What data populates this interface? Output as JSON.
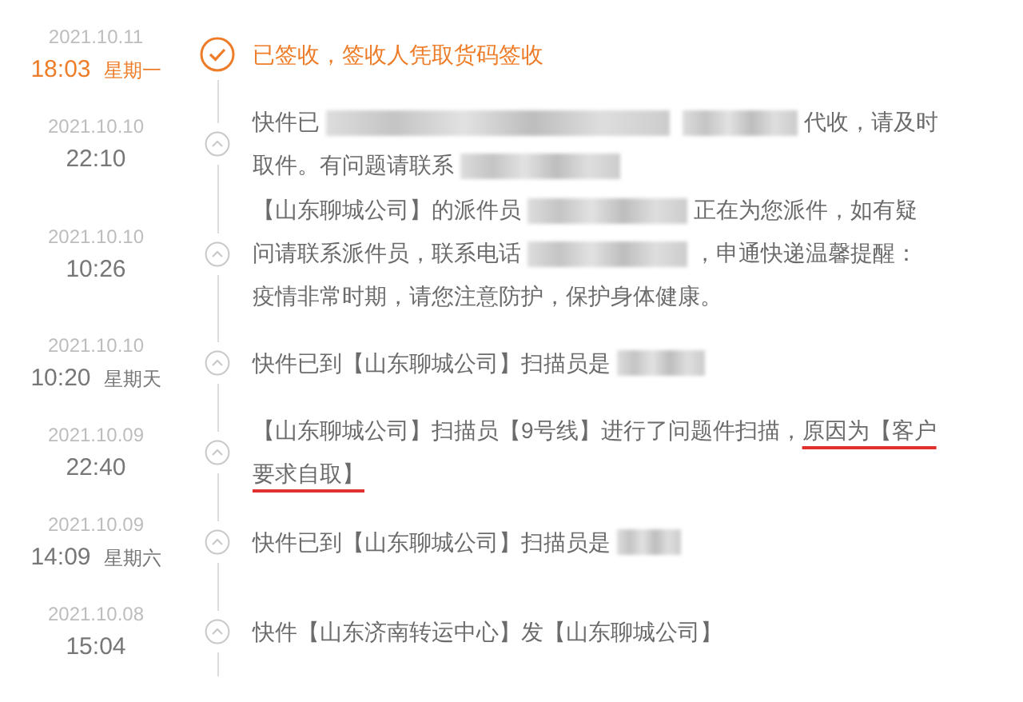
{
  "events": [
    {
      "date": "2021.10.11",
      "time": "18:03",
      "weekday": "星期一",
      "current": true,
      "lines": [
        [
          {
            "kind": "text",
            "text": "已签收，签收人凭取货码签收"
          }
        ]
      ]
    },
    {
      "date": "2021.10.10",
      "time": "22:10",
      "current": false,
      "lines": [
        [
          {
            "kind": "text",
            "text": "快件已"
          },
          {
            "kind": "redactedxl"
          },
          {
            "kind": "redactedm"
          },
          {
            "kind": "text",
            "text": "代收，请及时"
          }
        ],
        [
          {
            "kind": "text",
            "text": "取件。有问题请联系"
          },
          {
            "kind": "redactedl"
          }
        ]
      ]
    },
    {
      "date": "2021.10.10",
      "time": "10:26",
      "current": false,
      "lines": [
        [
          {
            "kind": "text",
            "text": "【山东聊城公司】的派件员"
          },
          {
            "kind": "redactedl"
          },
          {
            "kind": "text",
            "text": "正在为您派件，如有疑"
          }
        ],
        [
          {
            "kind": "text",
            "text": "问请联系派件员，联系电话"
          },
          {
            "kind": "redactedl"
          },
          {
            "kind": "text",
            "text": "，申通快递温馨提醒："
          }
        ],
        [
          {
            "kind": "text",
            "text": "疫情非常时期，请您注意防护，保护身体健康。"
          }
        ]
      ]
    },
    {
      "date": "2021.10.10",
      "time": "10:20",
      "weekday": "星期天",
      "current": false,
      "lines": [
        [
          {
            "kind": "text",
            "text": "快件已到【山东聊城公司】扫描员是"
          },
          {
            "kind": "redacteds"
          }
        ]
      ]
    },
    {
      "date": "2021.10.09",
      "time": "22:40",
      "current": false,
      "lines": [
        [
          {
            "kind": "text",
            "text": "【山东聊城公司】扫描员【9号线】进行了问题件扫描，"
          },
          {
            "kind": "text",
            "text": "原因为【客户",
            "underlined": true
          }
        ],
        [
          {
            "kind": "text",
            "text": "要求自取】",
            "underlined": true
          }
        ]
      ]
    },
    {
      "date": "2021.10.09",
      "time": "14:09",
      "weekday": "星期六",
      "current": false,
      "lines": [
        [
          {
            "kind": "text",
            "text": "快件已到【山东聊城公司】扫描员是"
          },
          {
            "kind": "redactedxs"
          }
        ]
      ]
    },
    {
      "date": "2021.10.08",
      "time": "15:04",
      "current": false,
      "lines": [
        [
          {
            "kind": "text",
            "text": "快件【山东济南转运中心】发【山东聊城公司】"
          }
        ]
      ]
    }
  ]
}
